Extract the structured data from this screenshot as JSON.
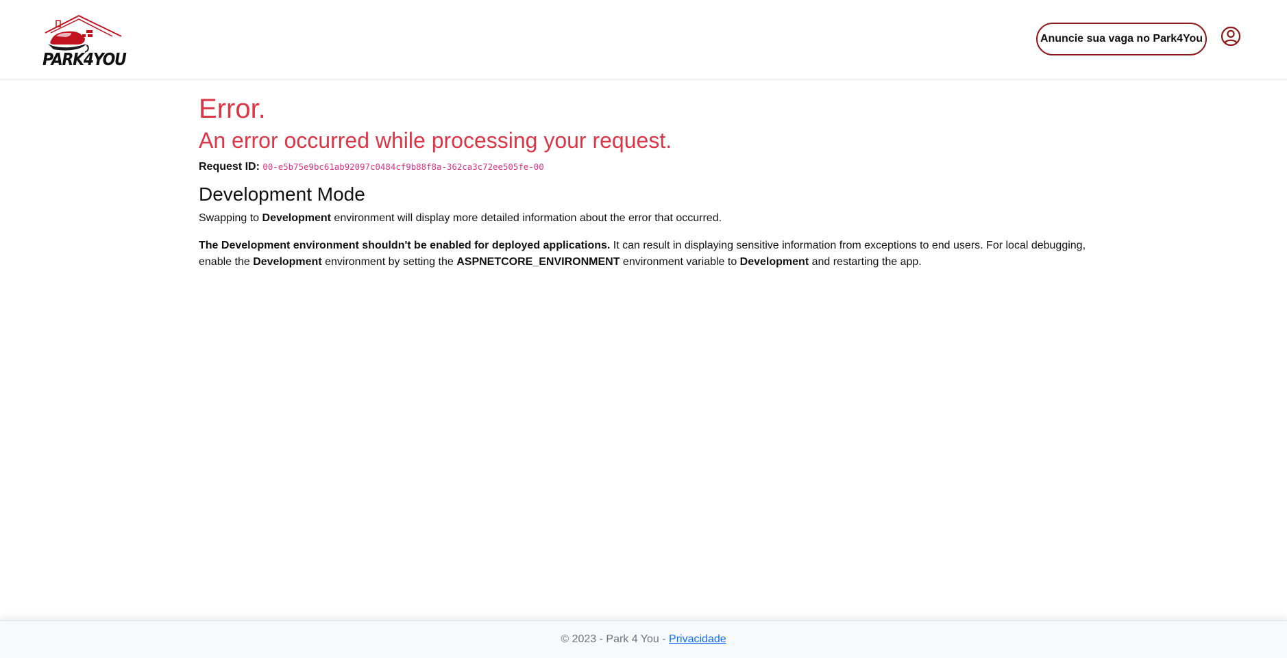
{
  "brand": {
    "logo_text": "PARK4YOU",
    "accent_red": "#c1121f",
    "dark": "#111111"
  },
  "header": {
    "cta_label": "Anuncie sua vaga no Park4You",
    "cta_border_color": "#8b1a1a",
    "user_icon": "user-circle-icon"
  },
  "error": {
    "title": "Error.",
    "subtitle": "An error occurred while processing your request.",
    "request_id_label": "Request ID:",
    "request_id_value": "00-e5b75e9bc61ab92097c0484cf9b88f8a-362ca3c72ee505fe-00",
    "color": "#dc3545"
  },
  "dev_mode": {
    "heading": "Development Mode",
    "p1": {
      "t1": "Swapping to ",
      "b1": "Development",
      "t2": " environment will display more detailed information about the error that occurred."
    },
    "p2": {
      "b1": "The Development environment shouldn't be enabled for deployed applications.",
      "t1": " It can result in displaying sensitive information from exceptions to end users. For local debugging, enable the ",
      "b2": "Development",
      "t2": " environment by setting the ",
      "b3": "ASPNETCORE_ENVIRONMENT",
      "t3": " environment variable to ",
      "b4": "Development",
      "t4": " and restarting the app."
    }
  },
  "footer": {
    "copyright": "© 2023 - Park 4 You - ",
    "privacy_link": "Privacidade"
  }
}
